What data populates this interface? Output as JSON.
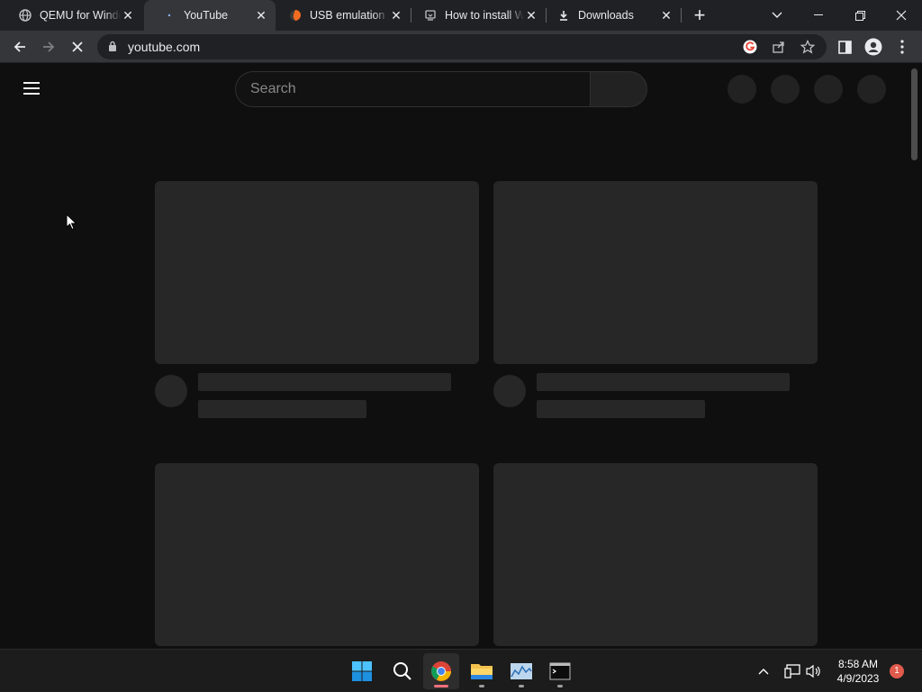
{
  "browser": {
    "tabs": [
      {
        "title": "QEMU for Windows",
        "favicon": "globe-icon",
        "active": false
      },
      {
        "title": "YouTube",
        "favicon": "loading-icon",
        "active": true
      },
      {
        "title": "USB emulation - QEMU",
        "favicon": "qemu-icon",
        "active": false
      },
      {
        "title": "How to install Windows",
        "favicon": "install-icon",
        "active": false
      },
      {
        "title": "Downloads",
        "favicon": "download-icon",
        "active": false
      }
    ],
    "new_tab_label": "+",
    "url": "youtube.com"
  },
  "youtube": {
    "search_placeholder": "Search"
  },
  "taskbar": {
    "time": "8:58 AM",
    "date": "4/9/2023",
    "notification_count": "1"
  },
  "colors": {
    "tab_bar": "#202124",
    "toolbar": "#35363a",
    "page_bg": "#0f0f0f",
    "skeleton": "#272727",
    "accent_active_indicator": "#f1707b"
  }
}
